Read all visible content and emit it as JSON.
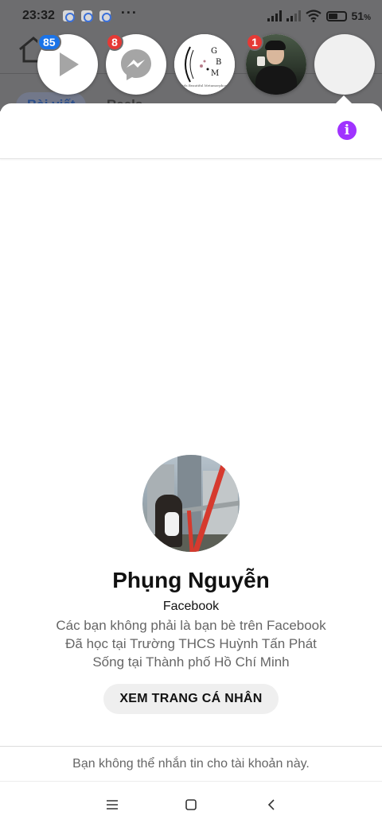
{
  "status_bar": {
    "time": "23:32",
    "more": "···",
    "battery": "51"
  },
  "background_app": {
    "tabs": [
      "Bài viết",
      "Reels"
    ]
  },
  "chat_heads": [
    {
      "id": "video",
      "badge": "85",
      "badge_color": "#1a73e8",
      "icon": "play-icon"
    },
    {
      "id": "messenger",
      "badge": "8",
      "badge_color": "#e53935",
      "icon": "messenger-icon"
    },
    {
      "id": "gbm",
      "badge": null,
      "logo_text": [
        "G",
        "B",
        "M"
      ],
      "logo_caption": "Girls Beautiful Metamorphosis"
    },
    {
      "id": "contact-photo",
      "badge": "1",
      "badge_color": "#e53935"
    },
    {
      "id": "blank",
      "badge": null
    }
  ],
  "profile": {
    "name": "Phụng Nguyễn",
    "source": "Facebook",
    "not_friends": "Các bạn không phải là bạn bè trên Facebook",
    "studied_at": "Đã học tại Trường THCS Huỳnh Tấn Phát",
    "lives_in": "Sống tại Thành phố Hồ Chí Minh",
    "view_profile_label": "XEM TRANG CÁ NHÂN"
  },
  "notice": "Bạn không thể nhắn tin cho tài khoản này.",
  "colors": {
    "info_accent": "#a033ff",
    "badge_blue": "#1a73e8",
    "badge_red": "#e53935"
  },
  "system_nav": [
    "menu-icon",
    "home-icon",
    "back-icon"
  ]
}
